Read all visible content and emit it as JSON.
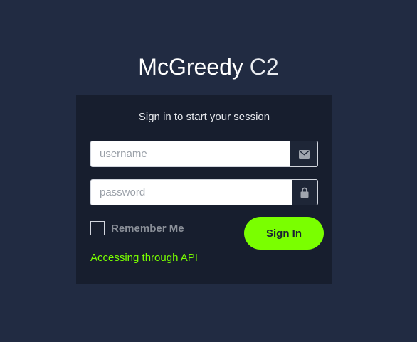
{
  "logo": {
    "main": "McGreedy",
    "suffix": "C2"
  },
  "login": {
    "message": "Sign in to start your session",
    "username": {
      "value": "",
      "placeholder": "username",
      "icon": "envelope-icon"
    },
    "password": {
      "value": "",
      "placeholder": "password",
      "icon": "lock-icon"
    },
    "remember_label": "Remember Me",
    "remember_checked": false,
    "signin_label": "Sign In",
    "api_link": "Accessing through API"
  },
  "colors": {
    "background": "#212b42",
    "card": "#171e2e",
    "accent": "#7aff00",
    "addon": "#1e2637"
  }
}
